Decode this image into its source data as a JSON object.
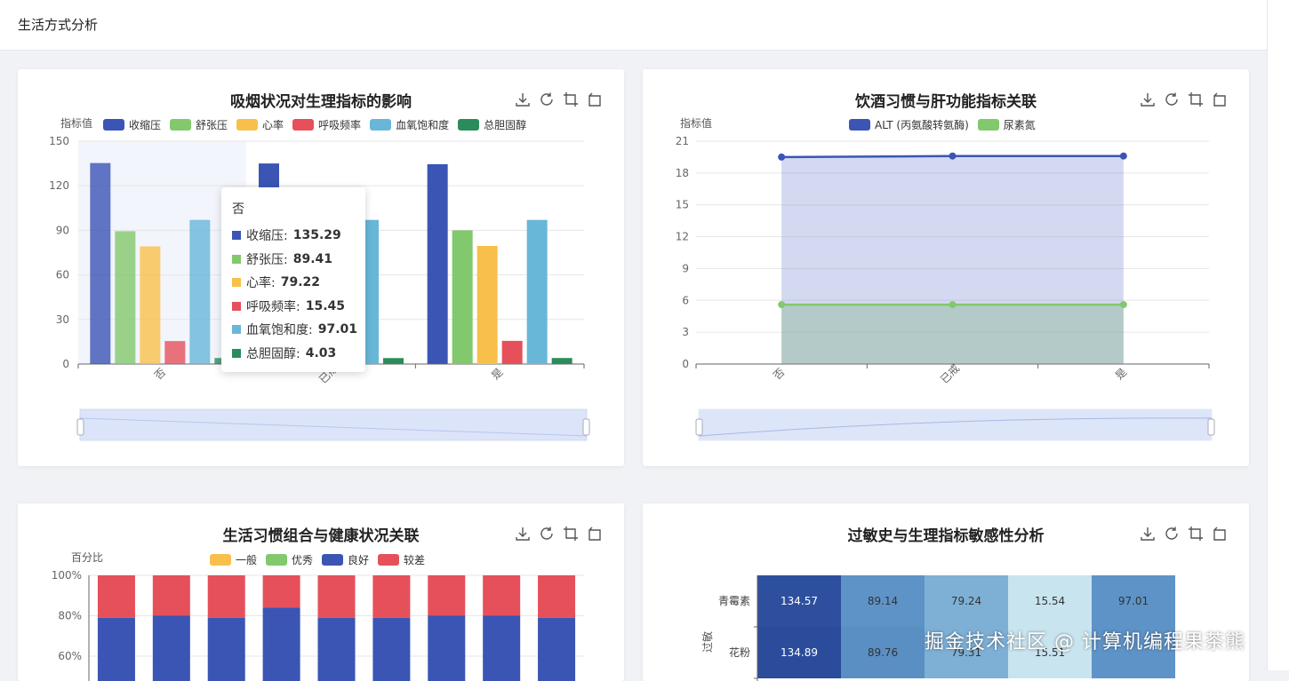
{
  "page": {
    "title": "生活方式分析"
  },
  "smoking_chart": {
    "title": "吸烟状况对生理指标的影响",
    "y_axis_name": "指标值",
    "legend": [
      {
        "label": "收缩压",
        "color": "#3a55b4"
      },
      {
        "label": "舒张压",
        "color": "#82c86c"
      },
      {
        "label": "心率",
        "color": "#f8c04a"
      },
      {
        "label": "呼吸频率",
        "color": "#e5505a"
      },
      {
        "label": "血氧饱和度",
        "color": "#68b7d9"
      },
      {
        "label": "总胆固醇",
        "color": "#2a8c5a"
      }
    ]
  },
  "tooltip": {
    "header": "否",
    "rows": [
      {
        "label": "收缩压:",
        "value": "135.29",
        "color": "#3a55b4"
      },
      {
        "label": "舒张压:",
        "value": "89.41",
        "color": "#82c86c"
      },
      {
        "label": "心率:",
        "value": "79.22",
        "color": "#f8c04a"
      },
      {
        "label": "呼吸频率:",
        "value": "15.45",
        "color": "#e5505a"
      },
      {
        "label": "血氧饱和度:",
        "value": "97.01",
        "color": "#68b7d9"
      },
      {
        "label": "总胆固醇:",
        "value": "4.03",
        "color": "#2a8c5a"
      }
    ]
  },
  "drinking_chart": {
    "title": "饮酒习惯与肝功能指标关联",
    "y_axis_name": "指标值",
    "legend": [
      {
        "label": "ALT (丙氨酸转氨酶)",
        "color": "#3a55b4"
      },
      {
        "label": "尿素氮",
        "color": "#82c86c"
      }
    ]
  },
  "habit_chart": {
    "title": "生活习惯组合与健康状况关联",
    "y_axis_name": "百分比",
    "legend": [
      {
        "label": "一般",
        "color": "#f8c04a"
      },
      {
        "label": "优秀",
        "color": "#82c86c"
      },
      {
        "label": "良好",
        "color": "#3a55b4"
      },
      {
        "label": "较差",
        "color": "#e5505a"
      }
    ]
  },
  "allergy_chart": {
    "title": "过敏史与生理指标敏感性分析",
    "y_axis_name": "过敏"
  },
  "watermark": "掘金技术社区 @ 计算机编程果茶熊",
  "chart_data": [
    {
      "type": "bar",
      "title": "吸烟状况对生理指标的影响",
      "ylabel": "指标值",
      "categories": [
        "否",
        "已戒",
        "是"
      ],
      "ylim": [
        0,
        150
      ],
      "yticks": [
        0,
        30,
        60,
        90,
        120,
        150
      ],
      "series": [
        {
          "name": "收缩压",
          "values": [
            135.29,
            135,
            134.5
          ]
        },
        {
          "name": "舒张压",
          "values": [
            89.41,
            89.5,
            90
          ]
        },
        {
          "name": "心率",
          "values": [
            79.22,
            79.3,
            79.5
          ]
        },
        {
          "name": "呼吸频率",
          "values": [
            15.45,
            15.5,
            15.6
          ]
        },
        {
          "name": "血氧饱和度",
          "values": [
            97.01,
            97.0,
            97.0
          ]
        },
        {
          "name": "总胆固醇",
          "values": [
            4.03,
            4.0,
            4.05
          ]
        }
      ],
      "legend": "top"
    },
    {
      "type": "area",
      "title": "饮酒习惯与肝功能指标关联",
      "ylabel": "指标值",
      "categories": [
        "否",
        "已戒",
        "是"
      ],
      "ylim": [
        0,
        21
      ],
      "yticks": [
        0,
        3,
        6,
        9,
        12,
        15,
        18,
        21
      ],
      "series": [
        {
          "name": "ALT (丙氨酸转氨酶)",
          "values": [
            19.5,
            19.6,
            19.6
          ]
        },
        {
          "name": "尿素氮",
          "values": [
            5.6,
            5.6,
            5.6
          ]
        }
      ],
      "legend": "top"
    },
    {
      "type": "bar",
      "title": "生活习惯组合与健康状况关联",
      "ylabel": "百分比",
      "stacked": true,
      "visible_ylim": [
        60,
        100
      ],
      "yticks": [
        "60%",
        "80%",
        "100%"
      ],
      "bar_count": 9,
      "series": [
        {
          "name": "良好",
          "values": [
            79,
            80,
            79,
            84,
            79,
            79,
            80,
            80,
            79
          ]
        },
        {
          "name": "较差",
          "values": [
            21,
            20,
            21,
            16,
            21,
            21,
            20,
            20,
            21
          ]
        }
      ],
      "legend": "top"
    },
    {
      "type": "heatmap",
      "title": "过敏史与生理指标敏感性分析",
      "ylabel": "过敏",
      "rows": [
        "青霉素",
        "花粉"
      ],
      "cells": [
        [
          "134.57",
          "89.14",
          "79.24",
          "15.54",
          "97.01"
        ],
        [
          "134.89",
          "89.76",
          "79.31",
          "15.51",
          ""
        ]
      ]
    }
  ]
}
